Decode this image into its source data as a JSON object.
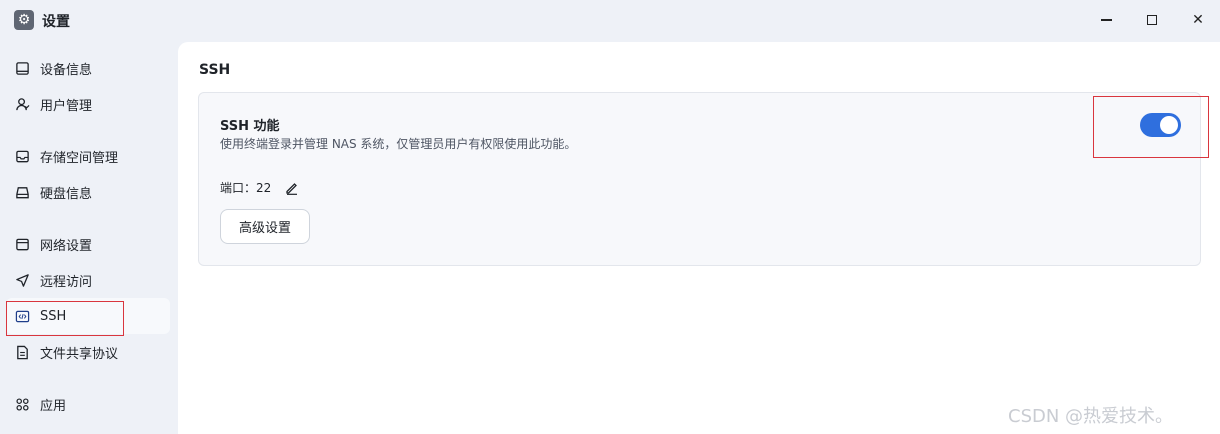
{
  "window": {
    "title": "设置",
    "minimize_icon": "minimize-icon",
    "maximize_icon": "maximize-icon",
    "close_glyph": "✕"
  },
  "sidebar": {
    "items": [
      {
        "label": "设备信息",
        "icon": "device-icon"
      },
      {
        "label": "用户管理",
        "icon": "user-icon"
      },
      {
        "label": "存储空间管理",
        "icon": "storage-icon"
      },
      {
        "label": "硬盘信息",
        "icon": "disk-icon"
      },
      {
        "label": "网络设置",
        "icon": "network-icon"
      },
      {
        "label": "远程访问",
        "icon": "send-icon"
      },
      {
        "label": "SSH",
        "icon": "code-icon",
        "active": true
      },
      {
        "label": "文件共享协议",
        "icon": "file-icon"
      },
      {
        "label": "应用",
        "icon": "apps-icon"
      }
    ]
  },
  "main": {
    "title": "SSH",
    "feature": {
      "title": "SSH 功能",
      "description": "使用终端登录并管理 NAS 系统，仅管理员用户有权限使用此功能。",
      "enabled": true,
      "port_label": "端口：",
      "port_value": "22",
      "advanced_button": "高级设置"
    }
  },
  "watermark": "CSDN @热爱技术。",
  "colors": {
    "accent": "#2f6fde",
    "highlight": "#d9363e",
    "sidebar_bg": "#eef1f7"
  }
}
